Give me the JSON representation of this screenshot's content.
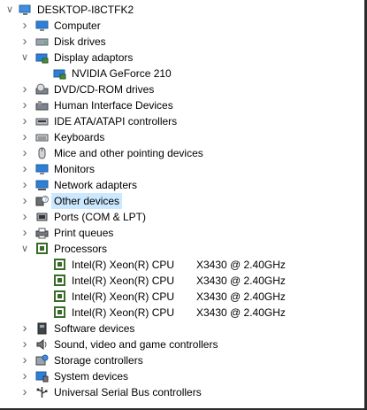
{
  "root": {
    "label": "DESKTOP-I8CTFK2",
    "icon": "computer-icon"
  },
  "categories": [
    {
      "id": "computer",
      "label": "Computer",
      "icon": "monitor-icon",
      "expanded": false
    },
    {
      "id": "disk",
      "label": "Disk drives",
      "icon": "disk-drive-icon",
      "expanded": false
    },
    {
      "id": "display",
      "label": "Display adaptors",
      "icon": "display-adapter-icon",
      "expanded": true,
      "children": [
        {
          "label": "NVIDIA GeForce 210",
          "icon": "display-adapter-icon"
        }
      ]
    },
    {
      "id": "dvd",
      "label": "DVD/CD-ROM drives",
      "icon": "dvd-drive-icon",
      "expanded": false
    },
    {
      "id": "hid",
      "label": "Human Interface Devices",
      "icon": "hid-icon",
      "expanded": false
    },
    {
      "id": "ide",
      "label": "IDE ATA/ATAPI controllers",
      "icon": "ide-controller-icon",
      "expanded": false
    },
    {
      "id": "keyboards",
      "label": "Keyboards",
      "icon": "keyboard-icon",
      "expanded": false
    },
    {
      "id": "mice",
      "label": "Mice and other pointing devices",
      "icon": "mouse-icon",
      "expanded": false
    },
    {
      "id": "monitors",
      "label": "Monitors",
      "icon": "monitor-icon",
      "expanded": false
    },
    {
      "id": "network",
      "label": "Network adapters",
      "icon": "network-adapter-icon",
      "expanded": false
    },
    {
      "id": "other",
      "label": "Other devices",
      "icon": "unknown-device-icon",
      "expanded": false,
      "selected": true
    },
    {
      "id": "ports",
      "label": "Ports (COM & LPT)",
      "icon": "port-icon",
      "expanded": false
    },
    {
      "id": "print",
      "label": "Print queues",
      "icon": "printer-icon",
      "expanded": false
    },
    {
      "id": "processors",
      "label": "Processors",
      "icon": "processor-icon",
      "expanded": true,
      "children": [
        {
          "label": "Intel(R) Xeon(R) CPU",
          "model": "X3430  @ 2.40GHz",
          "icon": "processor-icon"
        },
        {
          "label": "Intel(R) Xeon(R) CPU",
          "model": "X3430  @ 2.40GHz",
          "icon": "processor-icon"
        },
        {
          "label": "Intel(R) Xeon(R) CPU",
          "model": "X3430  @ 2.40GHz",
          "icon": "processor-icon"
        },
        {
          "label": "Intel(R) Xeon(R) CPU",
          "model": "X3430  @ 2.40GHz",
          "icon": "processor-icon"
        }
      ]
    },
    {
      "id": "software",
      "label": "Software devices",
      "icon": "software-device-icon",
      "expanded": false
    },
    {
      "id": "sound",
      "label": "Sound, video and game controllers",
      "icon": "speaker-icon",
      "expanded": false
    },
    {
      "id": "storage",
      "label": "Storage controllers",
      "icon": "storage-controller-icon",
      "expanded": false
    },
    {
      "id": "system",
      "label": "System devices",
      "icon": "system-device-icon",
      "expanded": false
    },
    {
      "id": "usb",
      "label": "Universal Serial Bus controllers",
      "icon": "usb-icon",
      "expanded": false
    }
  ],
  "colors": {
    "selection": "#cce8ff",
    "chevron": "#666666",
    "monitor_blue": "#2f7fd8",
    "processor_green": "#3a6b2a"
  }
}
